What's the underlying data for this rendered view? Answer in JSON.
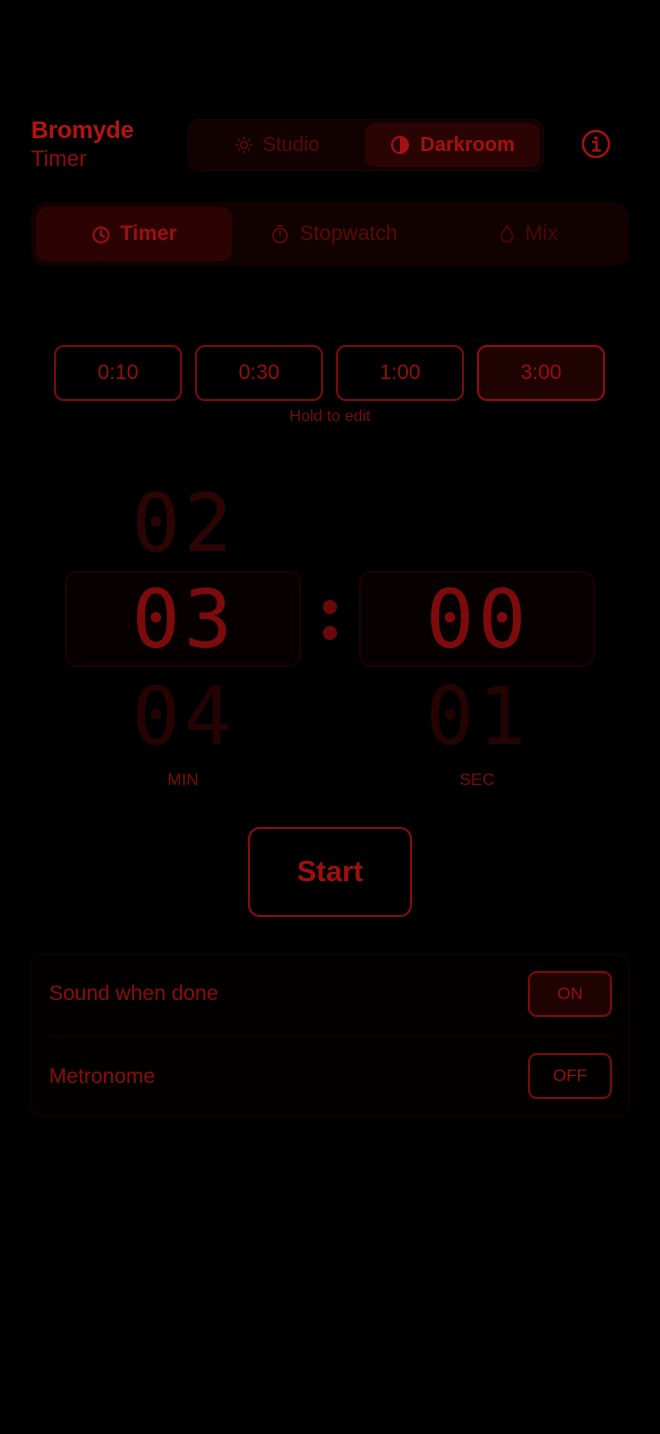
{
  "header": {
    "app_name": "Bromyde",
    "subtitle": "Timer",
    "theme_options": [
      {
        "label": "Studio",
        "icon": "sun-icon",
        "selected": false
      },
      {
        "label": "Darkroom",
        "icon": "contrast-icon",
        "selected": true
      }
    ],
    "info_icon": "info-icon"
  },
  "mode_tabs": [
    {
      "label": "Timer",
      "icon": "timer-icon",
      "selected": true
    },
    {
      "label": "Stopwatch",
      "icon": "stopwatch-icon",
      "selected": false
    },
    {
      "label": "Mix",
      "icon": "drop-icon",
      "selected": false
    }
  ],
  "presets": {
    "items": [
      {
        "label": "0:10",
        "selected": false
      },
      {
        "label": "0:30",
        "selected": false
      },
      {
        "label": "1:00",
        "selected": false
      },
      {
        "label": "3:00",
        "selected": true
      }
    ],
    "hint": "Hold to edit"
  },
  "picker": {
    "minutes": {
      "above": "02",
      "current": "03",
      "below": "04",
      "label": "MIN"
    },
    "seconds": {
      "above": "",
      "current": "00",
      "below": "01",
      "label": "SEC"
    }
  },
  "start_label": "Start",
  "settings": [
    {
      "label": "Sound when done",
      "state": "ON"
    },
    {
      "label": "Metronome",
      "state": "OFF"
    }
  ],
  "colors": {
    "background": "#000000",
    "accent": "#b01010"
  }
}
